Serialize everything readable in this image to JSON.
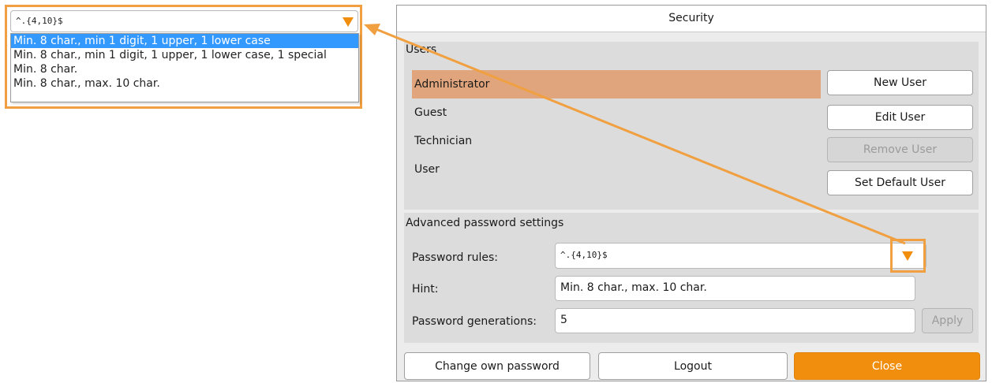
{
  "callout": {
    "combo_value": "^.{4,10}$",
    "options": [
      "Min. 8 char., min 1 digit, 1 upper, 1 lower case",
      "Min. 8 char., min 1 digit, 1 upper, 1 lower case, 1 special",
      "Min. 8 char.",
      "Min. 8 char., max. 10 char."
    ],
    "selected_index": 0
  },
  "window": {
    "title": "Security"
  },
  "users": {
    "section_title": "Users",
    "items": [
      "Administrator",
      "Guest",
      "Technician",
      "User"
    ],
    "selected_index": 0,
    "buttons": {
      "new_user": "New User",
      "edit_user": "Edit User",
      "remove_user": "Remove User",
      "set_default_user": "Set Default User"
    }
  },
  "advanced": {
    "section_title": "Advanced password settings",
    "password_rules_label": "Password rules:",
    "password_rules_value": "^.{4,10}$",
    "hint_label": "Hint:",
    "hint_value": "Min. 8 char., max. 10 char.",
    "generations_label": "Password generations:",
    "generations_value": "5",
    "apply_label": "Apply"
  },
  "footer": {
    "change_password": "Change own password",
    "logout": "Logout",
    "close": "Close"
  },
  "colors": {
    "accent": "#f18e0d",
    "highlight_outline": "#f0a040",
    "selected_user": "#e0a57c",
    "dropdown_selection": "#3399ff"
  },
  "icons": {
    "dropdown_arrow": "triangle-down-icon"
  }
}
